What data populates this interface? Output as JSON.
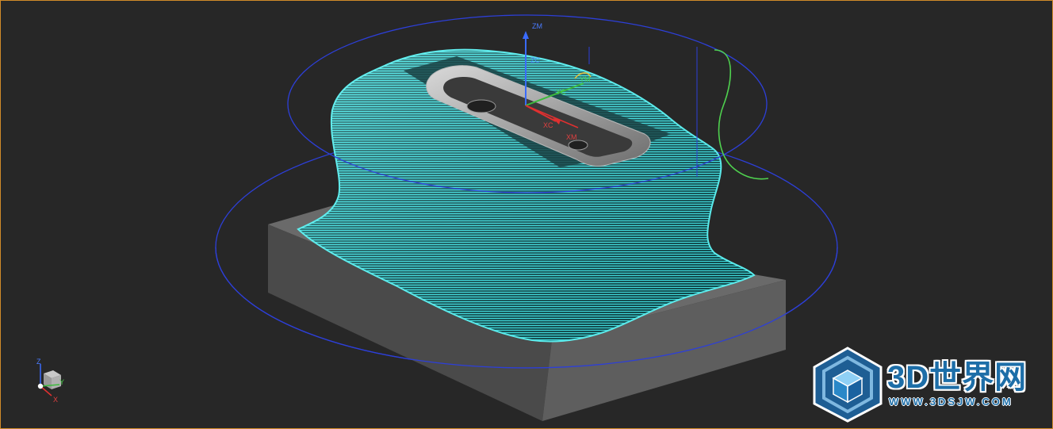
{
  "viewport": {
    "border_color": "#d08a2a",
    "background": "#272727"
  },
  "model": {
    "toolpath_color": "#3fe0e0",
    "stock_color": "#5b5b5b",
    "boundary_circle_color": "#2d3fd8",
    "guide_curve_color": "#4fd14f"
  },
  "csys": {
    "zm_label": "ZM",
    "zc_label": "ZC",
    "ym_label": "YM",
    "yc_label": "YC",
    "xc_label": "XC",
    "xm_label": "XM"
  },
  "triad": {
    "z_label": "Z",
    "y_label": "Y",
    "x_label": "X"
  },
  "watermark": {
    "title": "3D世界网",
    "url": "WWW.3DSJW.COM"
  }
}
